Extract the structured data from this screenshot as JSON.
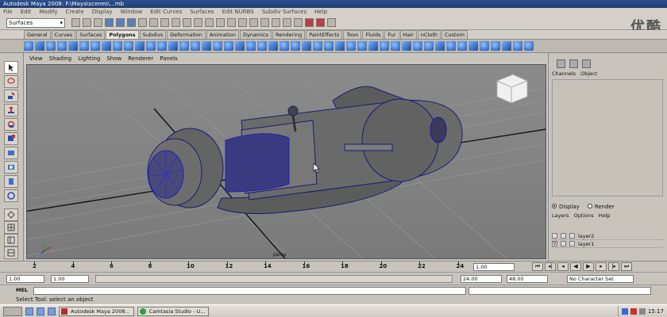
{
  "window": {
    "title": "Autodesk Maya 2008: F:\\Maya\\scenes\\...mb"
  },
  "menubar": [
    "File",
    "Edit",
    "Modify",
    "Create",
    "Display",
    "Window",
    "Edit Curves",
    "Surfaces",
    "Edit NURBS",
    "Subdiv Surfaces",
    "Help"
  ],
  "statusline": {
    "mode": "Surfaces",
    "watermark": "优酷"
  },
  "shelf": {
    "tabs": [
      "General",
      "Curves",
      "Surfaces",
      "Polygons",
      "Subdivs",
      "Deformation",
      "Animation",
      "Dynamics",
      "Rendering",
      "PaintEffects",
      "Toon",
      "Fluids",
      "Fur",
      "Hair",
      "nCloth",
      "Custom"
    ],
    "active_tab": "Polygons"
  },
  "viewport": {
    "menu": [
      "View",
      "Shading",
      "Lighting",
      "Show",
      "Renderer",
      "Panels"
    ],
    "camera_label": "persp"
  },
  "channelbox": {
    "header": [
      "Channels",
      "Object"
    ],
    "display_label": "Display",
    "render_label": "Render",
    "display_selected": true,
    "layer_menu": [
      "Layers",
      "Options",
      "Help"
    ],
    "layers": [
      {
        "visible": "",
        "name": "layer2"
      },
      {
        "visible": "V",
        "name": "layer1"
      }
    ]
  },
  "timeslider": {
    "ticks": [
      "2",
      "4",
      "6",
      "8",
      "10",
      "12",
      "14",
      "16",
      "18",
      "20",
      "22",
      "24"
    ],
    "current_frame": "1.00"
  },
  "rangeslider": {
    "start": "1.00",
    "anim_start": "1.00",
    "range_end": "24.00",
    "anim_end": "48.00",
    "character_set": "No Character Set"
  },
  "command": {
    "label": "MEL"
  },
  "helpline": "Select Tool: select an object",
  "taskbar": {
    "tasks": [
      "Autodesk Maya 2008...",
      "Camtasia Studio - U..."
    ],
    "clock": "15:17"
  }
}
